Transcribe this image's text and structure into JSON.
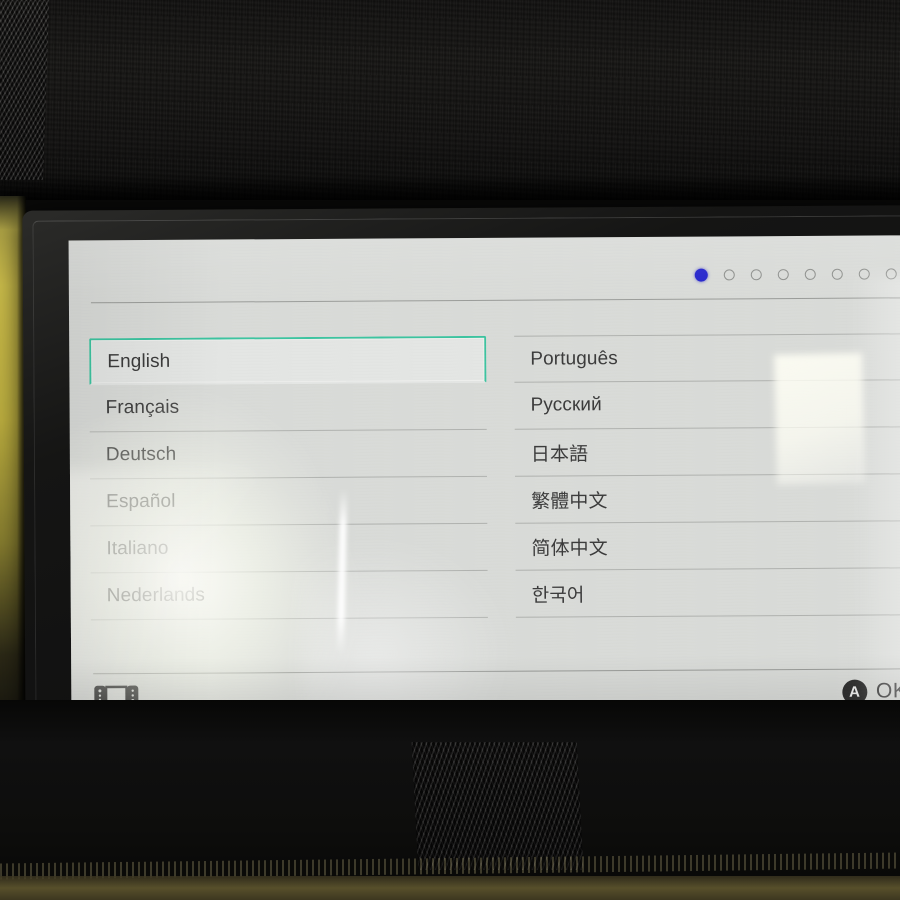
{
  "device": {
    "name": "nintendo-switch-handheld",
    "screen_label": "Language selection setup screen"
  },
  "screen": {
    "page_indicator": {
      "total": 8,
      "active_index": 0,
      "active_color": "#2222cc",
      "inactive_color": "#8d8f8c"
    },
    "selection": {
      "selected_value": "English",
      "highlight_color": "#3cc4a0"
    },
    "languages_left": [
      "English",
      "Français",
      "Deutsch",
      "Español",
      "Italiano",
      "Nederlands"
    ],
    "languages_right": [
      "Português",
      "Русский",
      "日本語",
      "繁體中文",
      "简体中文",
      "한국어"
    ],
    "bottom_bar": {
      "mode_icon": "nintendo-switch-console-icon",
      "confirm_button_glyph": "A",
      "confirm_label": "OK"
    }
  }
}
